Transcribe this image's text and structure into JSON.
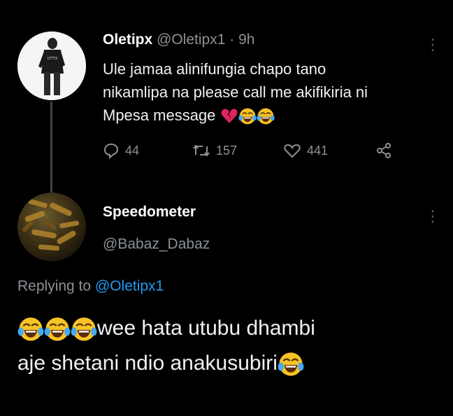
{
  "tweet1": {
    "display_name": "Oletipx",
    "handle": "@Oletipx1",
    "separator": "·",
    "time": "9h",
    "text_line1": "Ule jamaa alinifungia chapo tano",
    "text_line2": "nikamlipa na please call me akifikiria ni",
    "text_line3": "Mpesa message",
    "emojis": [
      "broken-heart-icon",
      "laughing-tears-icon",
      "laughing-tears-icon"
    ],
    "replies": "44",
    "retweets": "157",
    "likes": "441",
    "avatar_shirt_text": "LTTTX"
  },
  "tweet2": {
    "display_name": "Speedometer",
    "handle": "@Babaz_Dabaz",
    "replying_prefix": "Replying to",
    "replying_handle": "@Oletipx1",
    "text_line1": "wee hata utubu dhambi",
    "text_line2": "aje shetani ndio anakusubiri"
  },
  "colors": {
    "background": "#000000",
    "muted": "#8b9196",
    "link": "#1d9bf0",
    "thread_line": "#3d4245"
  }
}
